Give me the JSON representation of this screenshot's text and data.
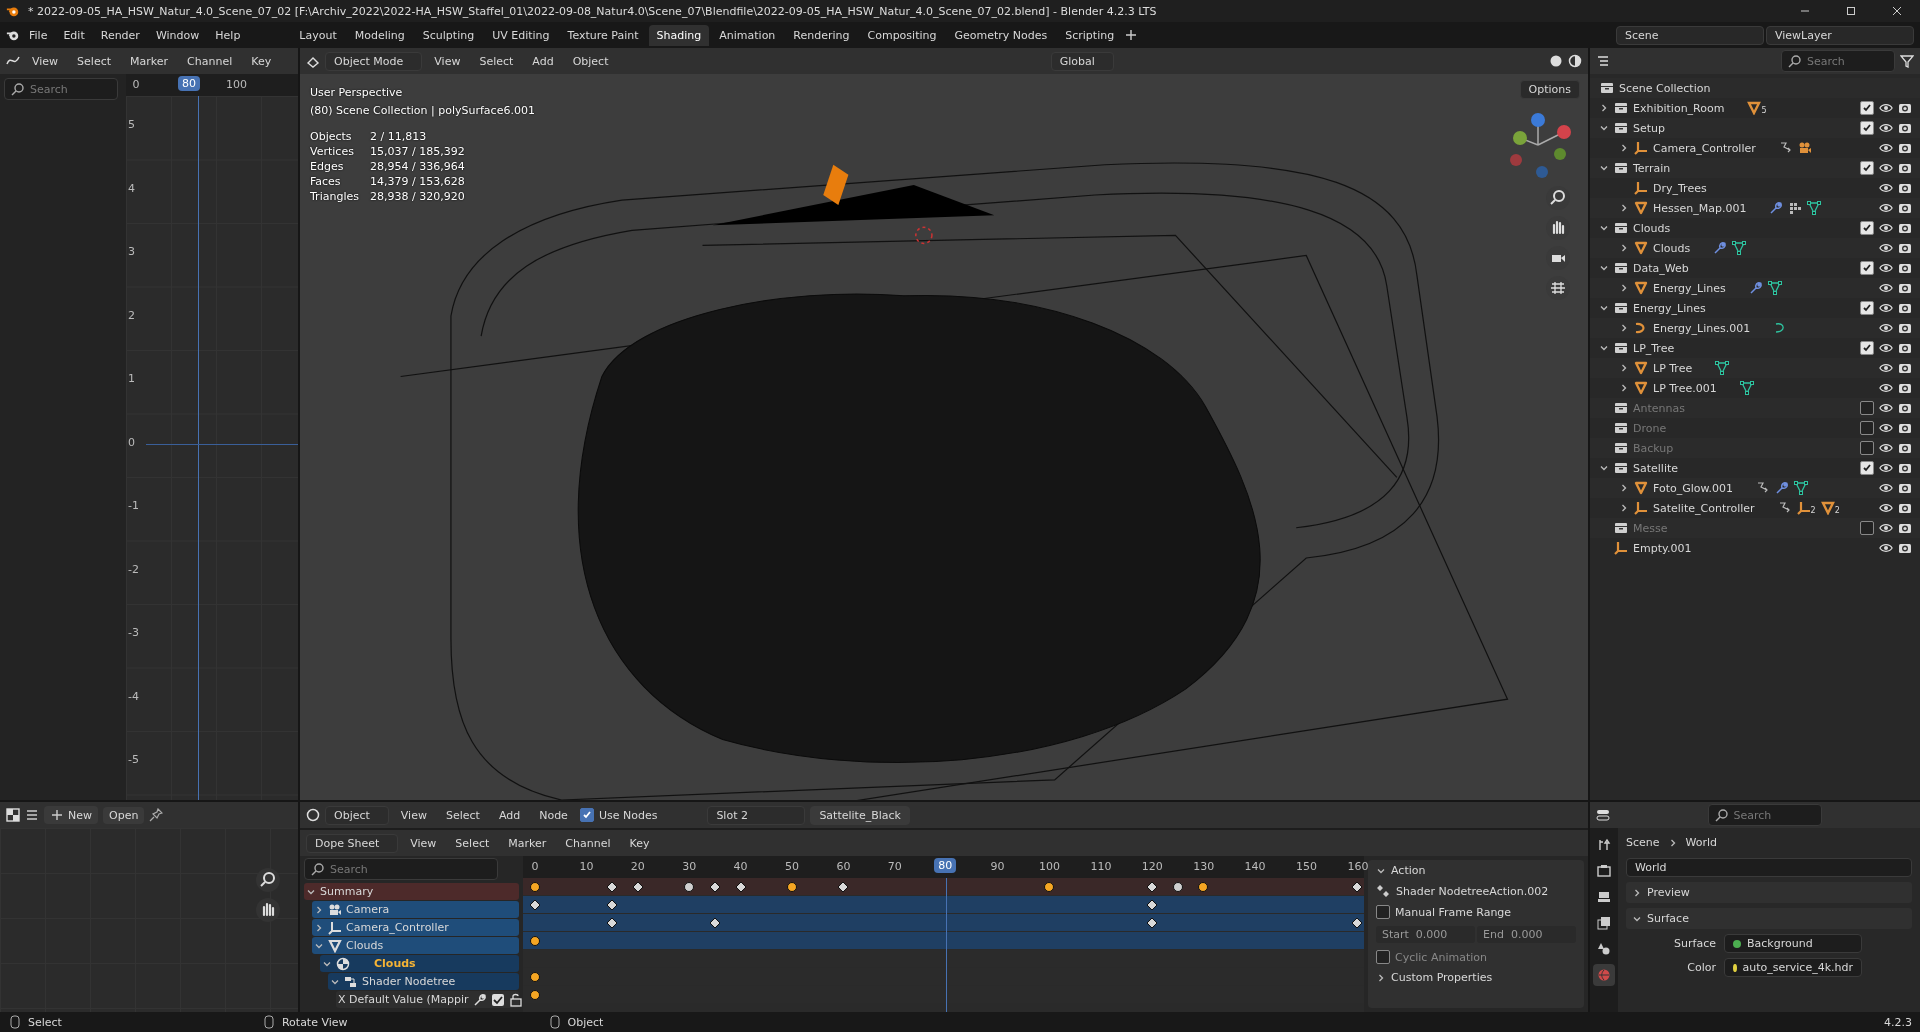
{
  "title_bar": {
    "title": "* 2022-09-05_HA_HSW_Natur_4.0_Scene_07_02 [F:\\Archiv_2022\\2022-HA_HSW_Staffel_01\\2022-09-08_Natur4.0\\Scene_07\\Blendfile\\2022-09-05_HA_HSW_Natur_4.0_Scene_07_02.blend] - Blender 4.2.3 LTS"
  },
  "menu": [
    "File",
    "Edit",
    "Render",
    "Window",
    "Help"
  ],
  "workspaces": [
    {
      "label": "Layout",
      "selected": false
    },
    {
      "label": "Modeling",
      "selected": false
    },
    {
      "label": "Sculpting",
      "selected": false
    },
    {
      "label": "UV Editing",
      "selected": false
    },
    {
      "label": "Texture Paint",
      "selected": false
    },
    {
      "label": "Shading",
      "selected": true
    },
    {
      "label": "Animation",
      "selected": false
    },
    {
      "label": "Rendering",
      "selected": false
    },
    {
      "label": "Compositing",
      "selected": false
    },
    {
      "label": "Geometry Nodes",
      "selected": false
    },
    {
      "label": "Scripting",
      "selected": false
    }
  ],
  "scene": "Scene",
  "view_layer": "ViewLayer",
  "graph_editor": {
    "menu": [
      "View",
      "Select",
      "Marker",
      "Channel",
      "Key"
    ],
    "search_placeholder": "Search",
    "ruler": [
      "0",
      "100"
    ],
    "current_frame": "80",
    "y_labels": [
      "5",
      "4",
      "3",
      "2",
      "1",
      "0",
      "-1",
      "-2",
      "-3",
      "-4",
      "-5"
    ]
  },
  "viewport": {
    "mode": "Object Mode",
    "menu": [
      "View",
      "Select",
      "Add",
      "Object"
    ],
    "orientation": "Global",
    "options": "Options",
    "overlay_lines": [
      "User Perspective",
      "(80) Scene Collection | polySurface6.001"
    ],
    "stats": [
      {
        "label": "Objects",
        "value": "2 / 11,813"
      },
      {
        "label": "Vertices",
        "value": "15,037 / 185,392"
      },
      {
        "label": "Edges",
        "value": "28,954 / 336,964"
      },
      {
        "label": "Faces",
        "value": "14,379 / 153,628"
      },
      {
        "label": "Triangles",
        "value": "28,938 / 320,920"
      }
    ]
  },
  "outliner": {
    "search_placeholder": "Search",
    "root": "Scene Collection",
    "items": [
      {
        "label": "Exhibition_Room",
        "kind": "collection",
        "checked": true,
        "expanded": false,
        "extras": [
          {
            "kind": "mesh",
            "count": "5"
          }
        ]
      },
      {
        "label": "Setup",
        "kind": "collection",
        "checked": true,
        "expanded": true,
        "children": [
          {
            "label": "Camera_Controller",
            "kind": "empty",
            "expanded": false,
            "extras": [
              {
                "kind": "constraint"
              },
              {
                "kind": "camera"
              }
            ]
          }
        ]
      },
      {
        "label": "Terrain",
        "kind": "collection",
        "checked": true,
        "expanded": true,
        "children": [
          {
            "label": "Dry_Trees",
            "kind": "empty"
          },
          {
            "label": "Hessen_Map.001",
            "kind": "mesh",
            "expanded": false,
            "extras": [
              {
                "kind": "wrench"
              },
              {
                "kind": "grid"
              },
              {
                "kind": "mesh-data"
              }
            ]
          }
        ]
      },
      {
        "label": "Clouds",
        "kind": "collection",
        "checked": true,
        "expanded": true,
        "children": [
          {
            "label": "Clouds",
            "kind": "mesh",
            "expanded": false,
            "extras": [
              {
                "kind": "wrench"
              },
              {
                "kind": "mesh-data"
              }
            ]
          }
        ]
      },
      {
        "label": "Data_Web",
        "kind": "collection",
        "checked": true,
        "expanded": true,
        "children": [
          {
            "label": "Energy_Lines",
            "kind": "mesh",
            "expanded": false,
            "extras": [
              {
                "kind": "wrench"
              },
              {
                "kind": "mesh-data"
              }
            ]
          }
        ]
      },
      {
        "label": "Energy_Lines",
        "kind": "collection",
        "checked": true,
        "expanded": true,
        "children": [
          {
            "label": "Energy_Lines.001",
            "kind": "curve",
            "expanded": false,
            "extras": [
              {
                "kind": "curve-data"
              }
            ]
          }
        ]
      },
      {
        "label": "LP_Tree",
        "kind": "collection",
        "checked": true,
        "expanded": true,
        "children": [
          {
            "label": "LP Tree",
            "kind": "mesh",
            "expanded": false,
            "extras": [
              {
                "kind": "mesh-data"
              }
            ]
          },
          {
            "label": "LP Tree.001",
            "kind": "mesh",
            "expanded": false,
            "extras": [
              {
                "kind": "mesh-data"
              }
            ]
          }
        ]
      },
      {
        "label": "Antennas",
        "kind": "collection",
        "checked": false
      },
      {
        "label": "Drone",
        "kind": "collection",
        "checked": false
      },
      {
        "label": "Backup",
        "kind": "collection",
        "checked": false
      },
      {
        "label": "Satellite",
        "kind": "collection",
        "checked": true,
        "expanded": true,
        "children": [
          {
            "label": "Foto_Glow.001",
            "kind": "mesh",
            "expanded": false,
            "extras": [
              {
                "kind": "constraint"
              },
              {
                "kind": "wrench"
              },
              {
                "kind": "mesh-data"
              }
            ]
          },
          {
            "label": "Satelite_Controller",
            "kind": "empty",
            "expanded": false,
            "extras": [
              {
                "kind": "constraint"
              },
              {
                "kind": "empty",
                "count": "2"
              },
              {
                "kind": "mesh",
                "count": "2"
              }
            ]
          }
        ]
      },
      {
        "label": "Messe",
        "kind": "collection",
        "checked": false
      },
      {
        "label": "Empty.001",
        "kind": "empty"
      }
    ]
  },
  "image_editor": {
    "new": "New",
    "open": "Open"
  },
  "shader_header": {
    "object": "Object",
    "menu": [
      "View",
      "Select",
      "Add",
      "Node"
    ],
    "use_nodes": {
      "label": "Use Nodes",
      "checked": true
    },
    "slot": "Slot 2",
    "material": "Sattelite_Black"
  },
  "dope_sheet": {
    "mode": "Dope Sheet",
    "menu": [
      "View",
      "Select",
      "Marker",
      "Channel",
      "Key"
    ],
    "search_placeholder": "Search",
    "frames": [
      "0",
      "10",
      "20",
      "30",
      "40",
      "50",
      "60",
      "70",
      "90",
      "100",
      "110",
      "120",
      "130",
      "140",
      "150",
      "160"
    ],
    "current_frame": "80",
    "channels": [
      {
        "label": "Summary",
        "kind": "summary",
        "expanded": true,
        "children": [
          {
            "label": "Camera",
            "kind": "camera",
            "expanded": false
          },
          {
            "label": "Camera_Controller",
            "kind": "empty",
            "expanded": false
          },
          {
            "label": "Clouds",
            "kind": "mesh",
            "expanded": true,
            "children": [
              {
                "label": "Clouds",
                "kind": "material",
                "expanded": true,
                "children": [
                  {
                    "label": "Shader Nodetree",
                    "kind": "nodetree",
                    "expanded": true,
                    "children": [
                      {
                        "label": "X Default Value (Mappir",
                        "kind": "fcurve"
                      }
                    ]
                  }
                ]
              }
            ]
          }
        ]
      }
    ]
  },
  "action_panel": {
    "title": "Action",
    "action": "Shader NodetreeAction.002",
    "manual_frame_range": {
      "label": "Manual Frame Range",
      "checked": false
    },
    "start": {
      "label": "Start",
      "value": "0.000"
    },
    "end": {
      "label": "End",
      "value": "0.000"
    },
    "cyclic": {
      "label": "Cyclic Animation",
      "checked": false
    },
    "custom_properties": "Custom Properties"
  },
  "properties": {
    "search_placeholder": "Search",
    "tabs": [
      {
        "kind": "tool",
        "selected": false
      },
      {
        "kind": "render",
        "selected": false
      },
      {
        "kind": "output",
        "selected": false
      },
      {
        "kind": "view-layer",
        "selected": false
      },
      {
        "kind": "scene",
        "selected": false
      },
      {
        "kind": "world",
        "selected": true
      }
    ],
    "breadcrumb": [
      "Scene",
      "World"
    ],
    "world": "World",
    "panels": [
      {
        "label": "Preview",
        "expanded": false
      },
      {
        "label": "Surface",
        "expanded": true
      }
    ],
    "fields": [
      {
        "label": "Surface",
        "value": "Background",
        "color": "#4caf50"
      },
      {
        "label": "Color",
        "value": "auto_service_4k.hdr",
        "color": "#e0d040"
      }
    ]
  },
  "status_bar": {
    "hints": [
      "Select",
      "Rotate View",
      "Object"
    ],
    "version": "4.2.3"
  }
}
